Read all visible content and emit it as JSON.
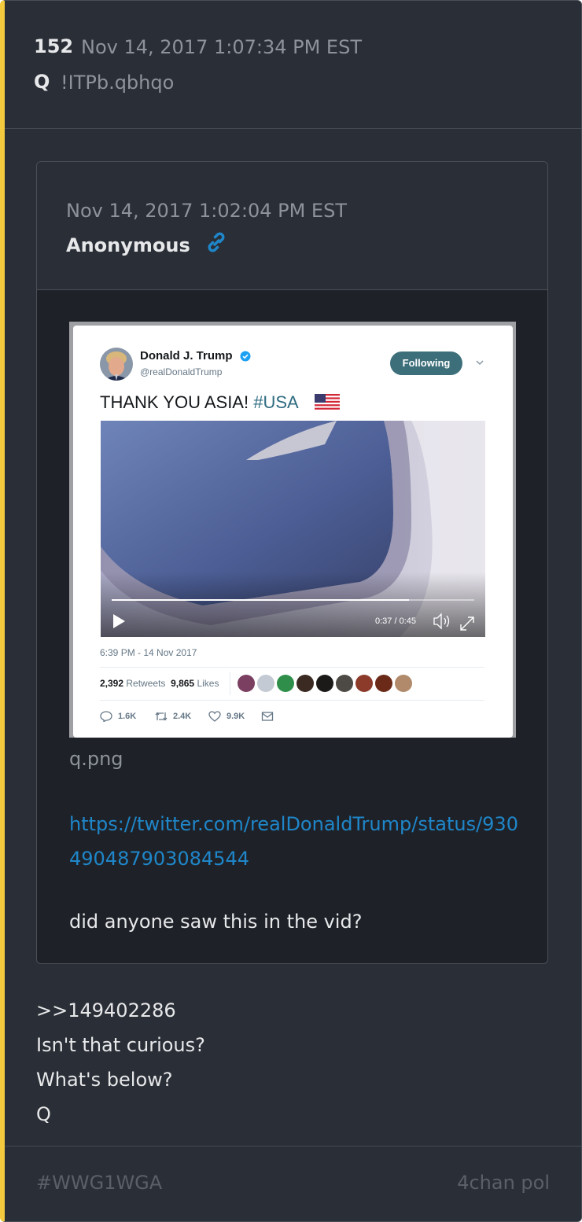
{
  "post": {
    "number": "152",
    "date": "Nov 14, 2017 1:07:34 PM EST",
    "author": "Q",
    "tripcode": "!ITPb.qbhqo",
    "body_lines": [
      ">>149402286",
      "Isn't that curious?",
      "What's below?",
      "Q"
    ]
  },
  "quoted": {
    "date": "Nov 14, 2017 1:02:04 PM EST",
    "author": "Anonymous",
    "file_name": "q.png",
    "link": "https://twitter.com/realDonaldTrump/status/930490487903084544",
    "body": "did anyone saw this in the vid?"
  },
  "tweet": {
    "name": "Donald J. Trump",
    "handle": "@realDonaldTrump",
    "follow_label": "Following",
    "text": "THANK YOU ASIA! ",
    "hashtag": "#USA",
    "video_time": "0:37 / 0:45",
    "video_progress": 0.82,
    "timestamp": "6:39 PM - 14 Nov 2017",
    "retweets_count": "2,392",
    "retweets_label": "Retweets",
    "likes_count": "9,865",
    "likes_label": "Likes",
    "replies": "1.6K",
    "retweets_short": "2.4K",
    "likes_short": "9.9K"
  },
  "footer": {
    "hashtag": "#WWG1WGA",
    "board": "4chan pol"
  },
  "colors": {
    "accent_bar": "#f3c93d",
    "link": "#1f86c9",
    "card_bg": "#2a2e36",
    "quote_bg": "#1e2228"
  },
  "icons": [
    "link-icon",
    "verified-icon",
    "chevron-down-icon",
    "flag-icon",
    "play-icon",
    "volume-icon",
    "fullscreen-icon",
    "reply-icon",
    "retweet-icon",
    "like-icon",
    "mail-icon"
  ]
}
